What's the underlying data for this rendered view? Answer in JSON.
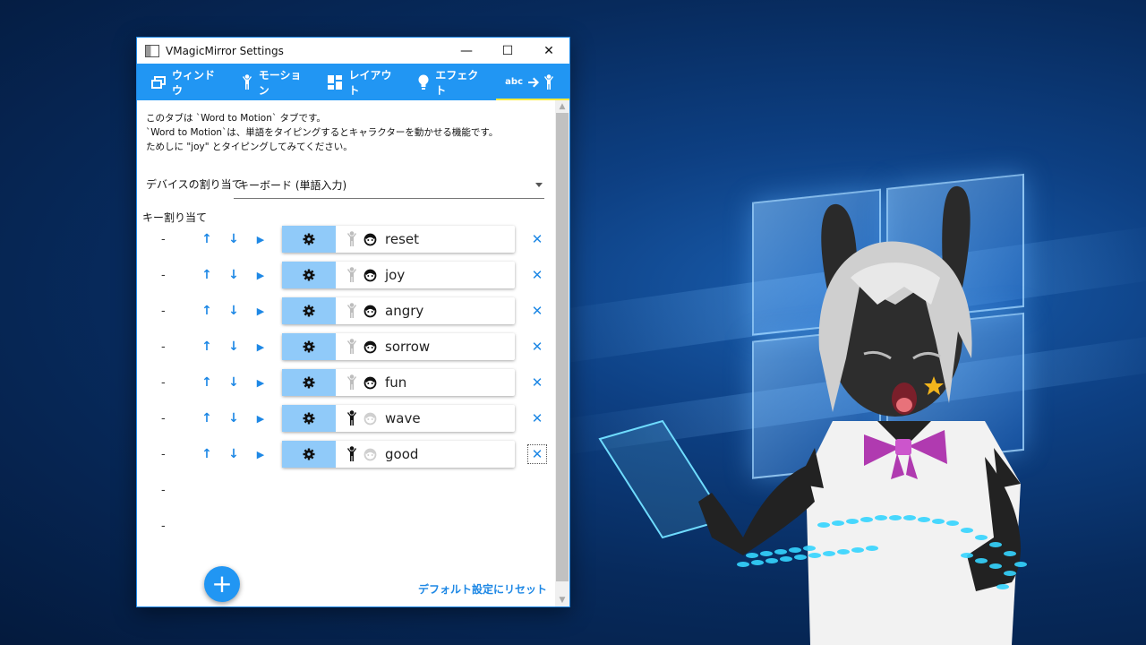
{
  "window": {
    "title": "VMagicMirror Settings",
    "controls": {
      "minimize": "—",
      "maximize": "☐",
      "close": "✕"
    }
  },
  "tabs": [
    {
      "label": "ウィンドウ",
      "icon": "window-icon"
    },
    {
      "label": "モーション",
      "icon": "person-icon"
    },
    {
      "label": "レイアウト",
      "icon": "layout-icon"
    },
    {
      "label": "エフェクト",
      "icon": "lightbulb-icon"
    },
    {
      "label": "",
      "icon_text": "abc",
      "icon": "word-to-motion-icon",
      "active": true
    }
  ],
  "description": [
    "このタブは `Word to Motion` タブです。",
    "`Word to Motion`は、単語をタイピングするとキャラクターを動かせる機能です。",
    "ためしに \"joy\" とタイピングしてみてください。"
  ],
  "device": {
    "label": "デバイスの割り当て",
    "value": "キーボード (単語入力)"
  },
  "keys_label": "キー割り当て",
  "rows": [
    {
      "dash": "-",
      "word": "reset",
      "motion_active": false,
      "face_active": true
    },
    {
      "dash": "-",
      "word": "joy",
      "motion_active": false,
      "face_active": true
    },
    {
      "dash": "-",
      "word": "angry",
      "motion_active": false,
      "face_active": true
    },
    {
      "dash": "-",
      "word": "sorrow",
      "motion_active": false,
      "face_active": true
    },
    {
      "dash": "-",
      "word": "fun",
      "motion_active": false,
      "face_active": true
    },
    {
      "dash": "-",
      "word": "wave",
      "motion_active": true,
      "face_active": false
    },
    {
      "dash": "-",
      "word": "good",
      "motion_active": true,
      "face_active": false
    }
  ],
  "empty_rows": [
    "-",
    "-"
  ],
  "row_buttons": {
    "up": "↑",
    "down": "↓",
    "play": "▶",
    "delete": "✕"
  },
  "add_button": "+",
  "reset_link": "デフォルト設定にリセット",
  "colors": {
    "accent": "#2196f3",
    "gear_bg": "#90caf9",
    "link": "#1e88e5"
  }
}
